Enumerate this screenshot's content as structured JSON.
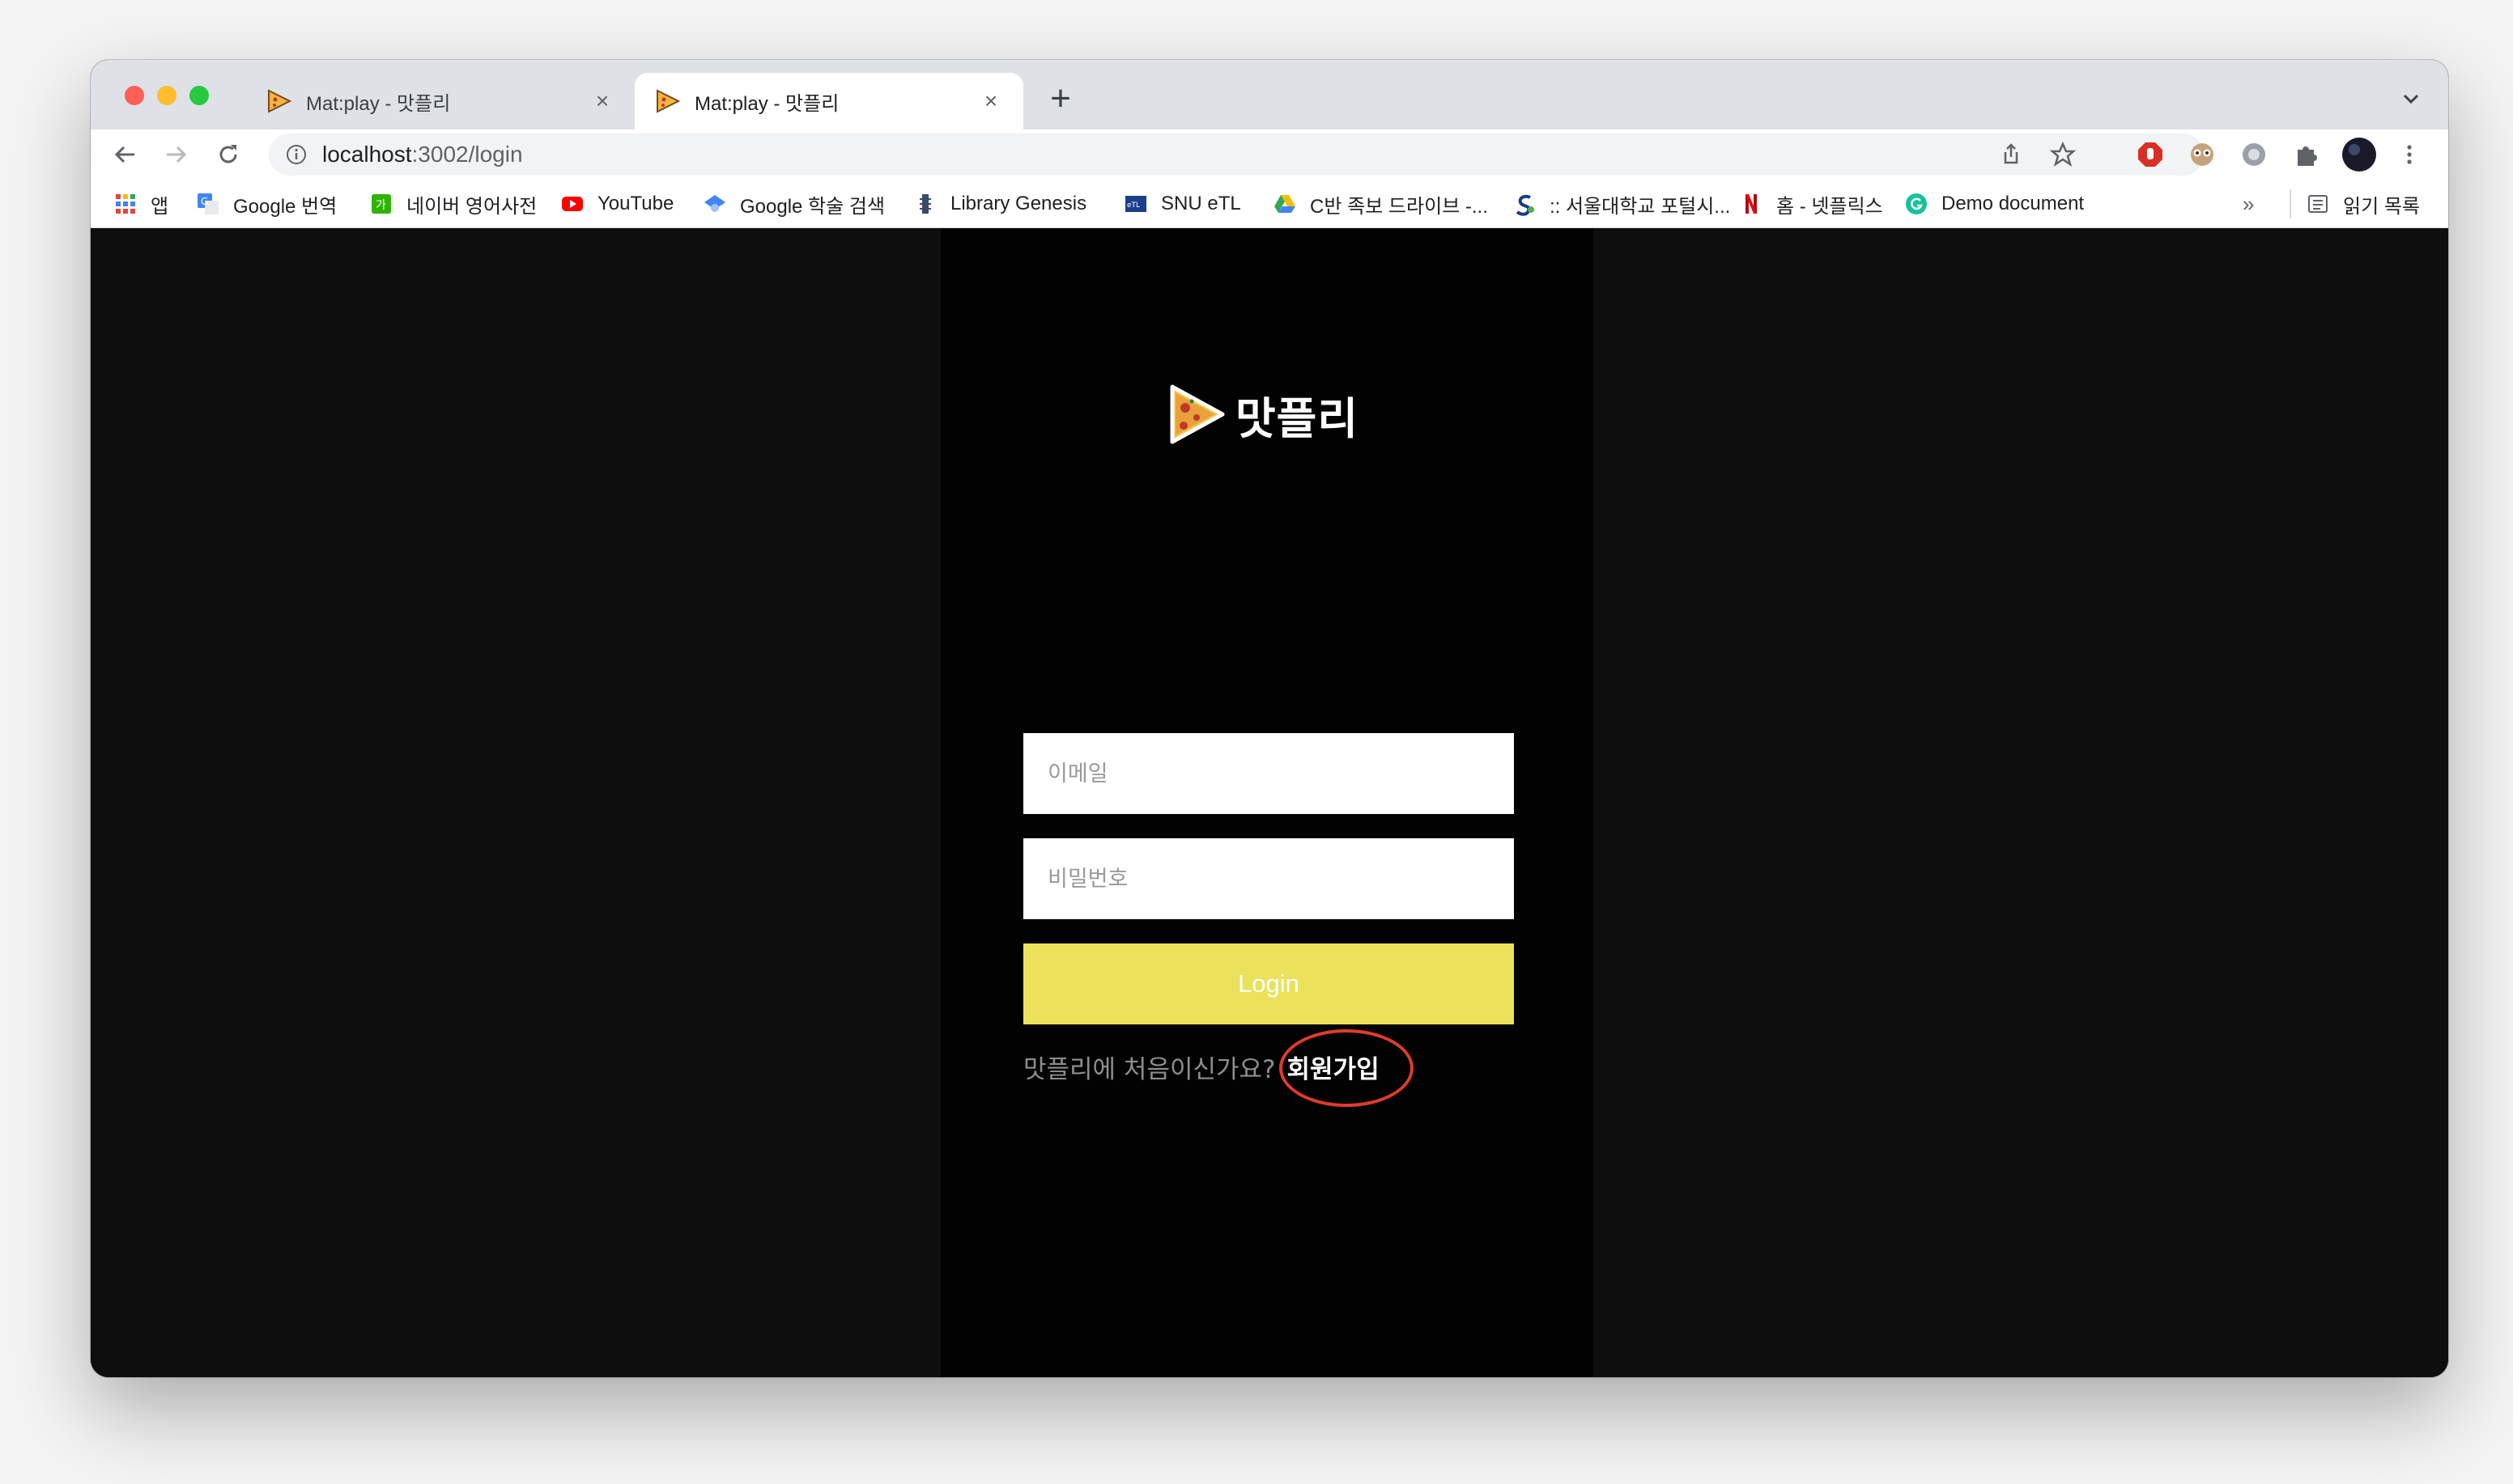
{
  "tabs": [
    {
      "title": "Mat:play - 맛플리",
      "active": false
    },
    {
      "title": "Mat:play - 맛플리",
      "active": true
    }
  ],
  "new_tab_label": "+",
  "tab_close_glyph": "×",
  "address": {
    "host": "localhost",
    "path": ":3002/login"
  },
  "bookmarks": [
    {
      "label": "앱",
      "icon": "apps-grid-icon"
    },
    {
      "label": "Google 번역",
      "icon": "google-translate-icon"
    },
    {
      "label": "네이버 영어사전",
      "icon": "naver-dictionary-icon"
    },
    {
      "label": "YouTube",
      "icon": "youtube-icon"
    },
    {
      "label": "Google 학술 검색",
      "icon": "google-scholar-icon"
    },
    {
      "label": "Library Genesis",
      "icon": "library-genesis-icon"
    },
    {
      "label": "SNU eTL",
      "icon": "snu-etl-icon"
    },
    {
      "label": "C반 족보 드라이브 -...",
      "icon": "google-drive-icon"
    },
    {
      "label": ":: 서울대학교 포털시...",
      "icon": "snu-portal-icon"
    },
    {
      "label": "홈 - 넷플릭스",
      "icon": "netflix-icon"
    },
    {
      "label": "Demo document",
      "icon": "grammarly-icon"
    }
  ],
  "bookmarks_overflow": "»",
  "reading_list": "읽기 목록",
  "app": {
    "brand": "맛플리",
    "email_placeholder": "이메일",
    "password_placeholder": "비밀번호",
    "login_label": "Login",
    "signup_prompt": "맛플리에 처음이신가요?",
    "signup_link": "회원가입"
  },
  "colors": {
    "login_button": "#ebe15a",
    "highlight_ring": "#e23a2c",
    "panel_bg": "#020202",
    "page_bg": "#0e0e0e"
  }
}
